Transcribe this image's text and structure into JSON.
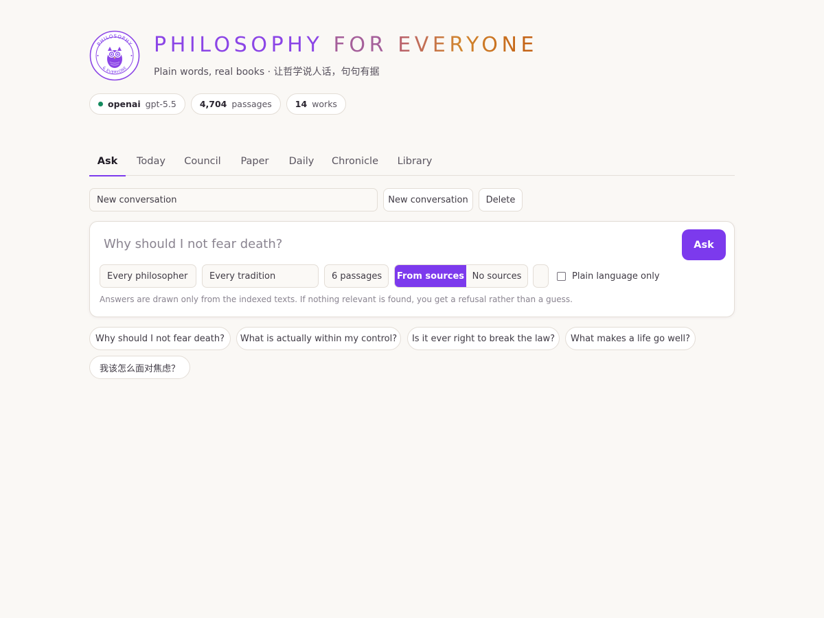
{
  "brand": {
    "title_parts": [
      {
        "text": "PHILOSOPHY",
        "color": "#8b45e6"
      },
      {
        "text": " ",
        "color": "#8b45e6"
      },
      {
        "text": "FOR",
        "color": "#a55f9a"
      },
      {
        "text": " ",
        "color": "#a55f9a"
      },
      {
        "text": "EVERYONE",
        "color": "#c96a2c"
      }
    ],
    "subtitle": "Plain words, real books · 让哲学说人话，句句有据",
    "logo_top": "PHILOSOPHY",
    "logo_bottom": "& EVERYONE",
    "accent": "#7c3aed"
  },
  "stats": {
    "provider": "openai",
    "model": "gpt-5.5",
    "passages_count": "4,704",
    "passages_label": "passages",
    "works_count": "14",
    "works_label": "works",
    "status_color": "#138a5e"
  },
  "tabs": [
    "Ask",
    "Today",
    "Council",
    "Paper",
    "Daily",
    "Chronicle",
    "Library"
  ],
  "active_tab": "Ask",
  "conversation": {
    "select_value": "New conversation",
    "new_label": "New conversation",
    "delete_label": "Delete"
  },
  "ask": {
    "placeholder": "Why should I not fear death?",
    "button_label": "Ask",
    "philosopher": "Every philosopher",
    "tradition": "Every tradition",
    "passages": "6 passages",
    "mode_on": "From sources",
    "mode_off": "No sources",
    "plain_language_label": "Plain language only",
    "plain_language_checked": false,
    "note": "Answers are drawn only from the indexed texts. If nothing relevant is found, you get a refusal rather than a guess."
  },
  "suggestions": [
    "Why should I not fear death?",
    "What is actually within my control?",
    "Is it ever right to break the law?",
    "What makes a life go well?",
    "我该怎么面对焦虑？"
  ]
}
